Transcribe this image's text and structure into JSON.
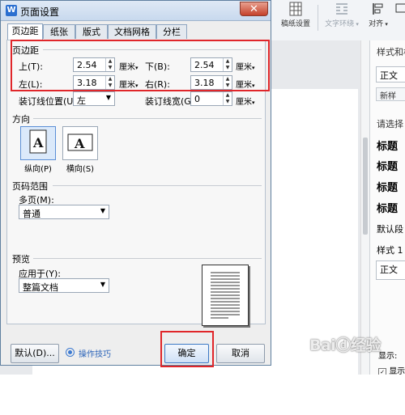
{
  "app": {
    "ribbon": {
      "paper_setting": "稿纸设置",
      "text_wrap": "文字环绕",
      "align": "对齐"
    },
    "panel": {
      "title_partial": "样式和格",
      "style_value": "正文",
      "new_style": "新样",
      "select_hint": "请选择",
      "headings": [
        "标题",
        "标题",
        "标题",
        "标题"
      ],
      "default_text": "默认段",
      "style1": "样式 1",
      "body_box": "正文",
      "show_label": "显示:",
      "show_check": "显示"
    },
    "watermark": "Baiⓓ经验"
  },
  "dialog": {
    "title": "页面设置",
    "close_symbol": "✕",
    "tabs": [
      "页边距",
      "纸张",
      "版式",
      "文档网格",
      "分栏"
    ],
    "active_tab": 0,
    "margins": {
      "section_label": "页边距",
      "top_label": "上(T):",
      "top_value": "2.54",
      "bottom_label": "下(B):",
      "bottom_value": "2.54",
      "left_label": "左(L):",
      "left_value": "3.18",
      "right_label": "右(R):",
      "right_value": "3.18",
      "unit": "厘米",
      "gutter_pos_label": "装订线位置(U):",
      "gutter_pos_value": "左",
      "gutter_width_label": "装订线宽(G):",
      "gutter_width_value": "0"
    },
    "orientation": {
      "section_label": "方向",
      "portrait_label": "纵向(P)",
      "landscape_label": "横向(S)",
      "selected": "portrait"
    },
    "page_range": {
      "section_label": "页码范围",
      "multi_label": "多页(M):",
      "multi_value": "普通"
    },
    "preview": {
      "section_label": "预览",
      "apply_label": "应用于(Y):",
      "apply_value": "整篇文档"
    },
    "buttons": {
      "default": "默认(D)...",
      "tips": "操作技巧",
      "ok": "确定",
      "cancel": "取消"
    },
    "highlight_color": "#e0262a"
  }
}
